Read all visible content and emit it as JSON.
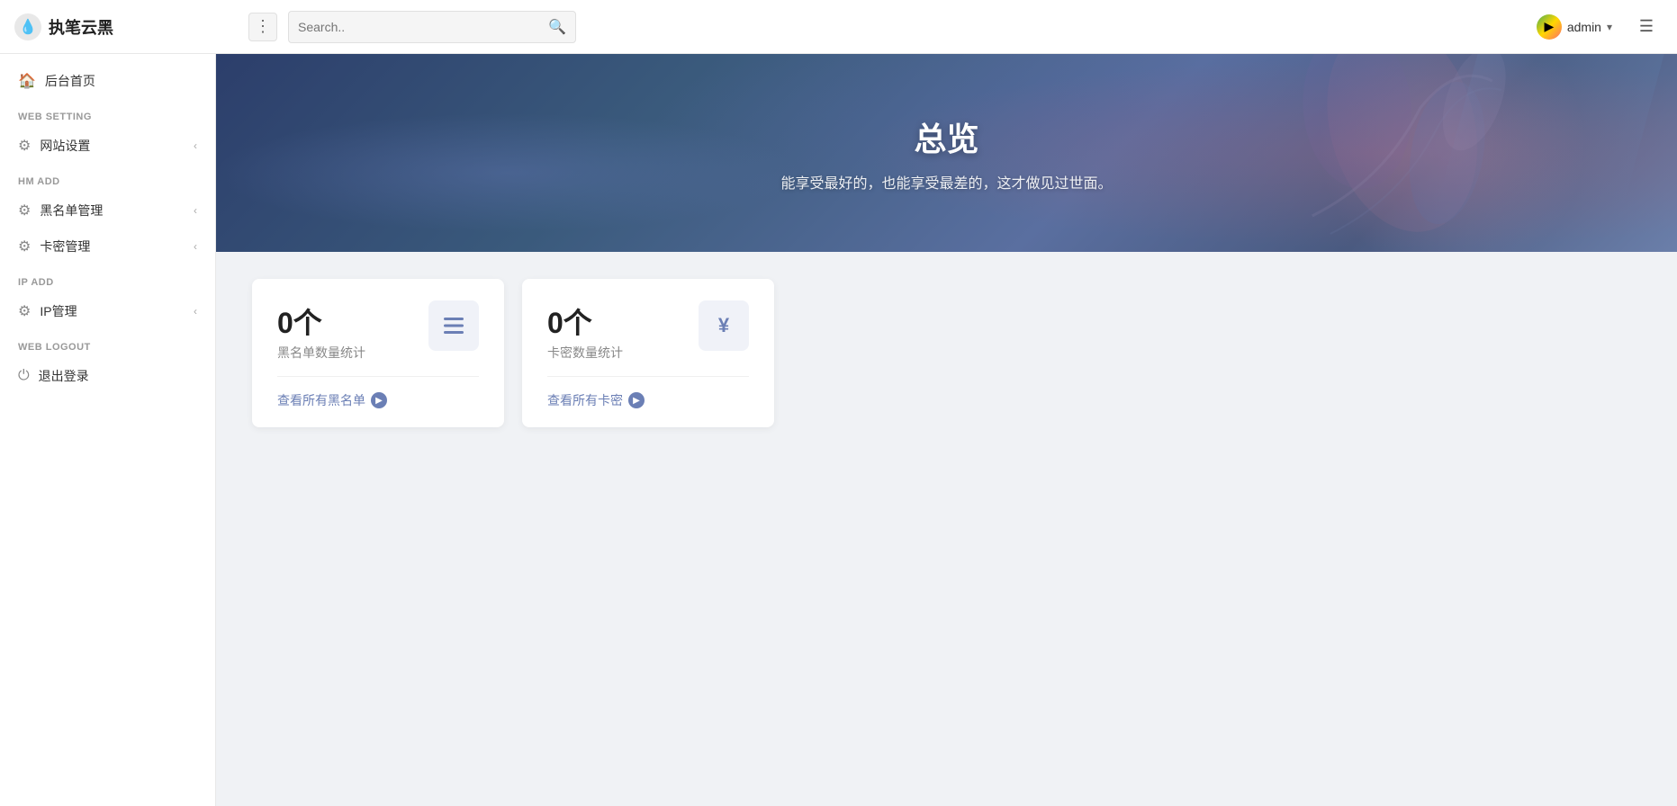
{
  "header": {
    "logo_icon": "💧",
    "logo_text": "执笔云黑",
    "three_dots": "⋮",
    "search_placeholder": "Search..",
    "search_icon": "🔍",
    "user_avatar": "▶",
    "user_name": "admin",
    "chevron": "▾",
    "menu_icon": "☰"
  },
  "sidebar": {
    "section_home": "",
    "home_item": "后台首页",
    "home_icon": "🏠",
    "section_web_setting": "WEB SETTING",
    "web_setting_item": "网站设置",
    "web_setting_icon": "⚙",
    "section_hm_add": "HM ADD",
    "blacklist_item": "黑名单管理",
    "blacklist_icon": "⚙",
    "card_item": "卡密管理",
    "card_icon": "⚙",
    "section_ip_add": "IP ADD",
    "ip_item": "IP管理",
    "ip_icon": "⚙",
    "section_logout": "WEB LOGOUT",
    "logout_item": "退出登录",
    "logout_icon": "⏻"
  },
  "banner": {
    "title": "总览",
    "subtitle": "能享受最好的，也能享受最差的，这才做见过世面。"
  },
  "cards": [
    {
      "count": "0个",
      "label": "黑名单数量统计",
      "icon_type": "list",
      "link_text": "查看所有黑名单",
      "id": "blacklist-card"
    },
    {
      "count": "0个",
      "label": "卡密数量统计",
      "icon_type": "yen",
      "link_text": "查看所有卡密",
      "id": "cardkey-card"
    }
  ]
}
